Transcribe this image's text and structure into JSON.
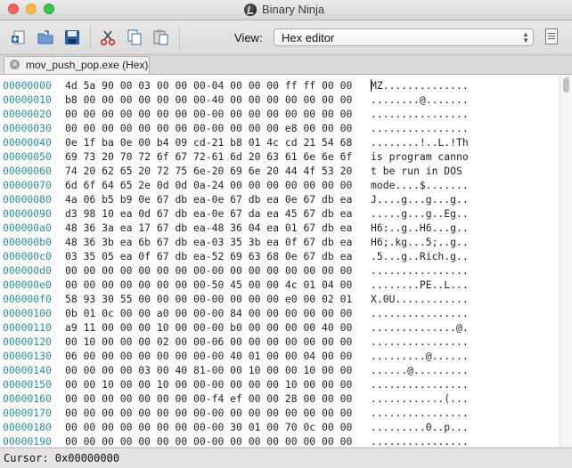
{
  "window": {
    "title": "Binary Ninja",
    "colors": {
      "close": "#fc605c",
      "minimize": "#fdbc40",
      "maximize": "#34c84a"
    }
  },
  "toolbar": {
    "buttons": [
      "new-file-icon",
      "open-file-icon",
      "save-icon",
      "cut-icon",
      "copy-icon",
      "paste-icon"
    ],
    "view_label": "View:",
    "view_value": "Hex editor"
  },
  "tab": {
    "label": "mov_push_pop.exe (Hex)"
  },
  "hex": {
    "address_color": "#2a8e9c",
    "rows": [
      {
        "addr": "00000000",
        "bytes": "4d 5a 90 00 03 00 00 00-04 00 00 00 ff ff 00 00",
        "ascii": "MZ.............."
      },
      {
        "addr": "00000010",
        "bytes": "b8 00 00 00 00 00 00 00-40 00 00 00 00 00 00 00",
        "ascii": "........@......."
      },
      {
        "addr": "00000020",
        "bytes": "00 00 00 00 00 00 00 00-00 00 00 00 00 00 00 00",
        "ascii": "................"
      },
      {
        "addr": "00000030",
        "bytes": "00 00 00 00 00 00 00 00-00 00 00 00 e8 00 00 00",
        "ascii": "................"
      },
      {
        "addr": "00000040",
        "bytes": "0e 1f ba 0e 00 b4 09 cd-21 b8 01 4c cd 21 54 68",
        "ascii": "........!..L.!Th"
      },
      {
        "addr": "00000050",
        "bytes": "69 73 20 70 72 6f 67 72-61 6d 20 63 61 6e 6e 6f",
        "ascii": "is program canno"
      },
      {
        "addr": "00000060",
        "bytes": "74 20 62 65 20 72 75 6e-20 69 6e 20 44 4f 53 20",
        "ascii": "t be run in DOS "
      },
      {
        "addr": "00000070",
        "bytes": "6d 6f 64 65 2e 0d 0d 0a-24 00 00 00 00 00 00 00",
        "ascii": "mode....$......."
      },
      {
        "addr": "00000080",
        "bytes": "4a 06 b5 b9 0e 67 db ea-0e 67 db ea 0e 67 db ea",
        "ascii": "J....g...g...g.."
      },
      {
        "addr": "00000090",
        "bytes": "d3 98 10 ea 0d 67 db ea-0e 67 da ea 45 67 db ea",
        "ascii": ".....g...g..Eg.."
      },
      {
        "addr": "000000a0",
        "bytes": "48 36 3a ea 17 67 db ea-48 36 04 ea 01 67 db ea",
        "ascii": "H6:..g..H6...g.."
      },
      {
        "addr": "000000b0",
        "bytes": "48 36 3b ea 6b 67 db ea-03 35 3b ea 0f 67 db ea",
        "ascii": "H6;.kg...5;..g.."
      },
      {
        "addr": "000000c0",
        "bytes": "03 35 05 ea 0f 67 db ea-52 69 63 68 0e 67 db ea",
        "ascii": ".5...g..Rich.g.."
      },
      {
        "addr": "000000d0",
        "bytes": "00 00 00 00 00 00 00 00-00 00 00 00 00 00 00 00",
        "ascii": "................"
      },
      {
        "addr": "000000e0",
        "bytes": "00 00 00 00 00 00 00 00-50 45 00 00 4c 01 04 00",
        "ascii": "........PE..L..."
      },
      {
        "addr": "000000f0",
        "bytes": "58 93 30 55 00 00 00 00-00 00 00 00 e0 00 02 01",
        "ascii": "X.0U............"
      },
      {
        "addr": "00000100",
        "bytes": "0b 01 0c 00 00 a0 00 00-00 84 00 00 00 00 00 00",
        "ascii": "................"
      },
      {
        "addr": "00000110",
        "bytes": "a9 11 00 00 00 10 00 00-00 b0 00 00 00 00 40 00",
        "ascii": "..............@."
      },
      {
        "addr": "00000120",
        "bytes": "00 10 00 00 00 02 00 00-06 00 00 00 00 00 00 00",
        "ascii": "................"
      },
      {
        "addr": "00000130",
        "bytes": "06 00 00 00 00 00 00 00-00 40 01 00 00 04 00 00",
        "ascii": ".........@......"
      },
      {
        "addr": "00000140",
        "bytes": "00 00 00 00 03 00 40 81-00 00 10 00 00 10 00 00",
        "ascii": "......@........."
      },
      {
        "addr": "00000150",
        "bytes": "00 00 10 00 00 10 00 00-00 00 00 00 10 00 00 00",
        "ascii": "................"
      },
      {
        "addr": "00000160",
        "bytes": "00 00 00 00 00 00 00 00-f4 ef 00 00 28 00 00 00",
        "ascii": "............(..."
      },
      {
        "addr": "00000170",
        "bytes": "00 00 00 00 00 00 00 00-00 00 00 00 00 00 00 00",
        "ascii": "................"
      },
      {
        "addr": "00000180",
        "bytes": "00 00 00 00 00 00 00 00-00 30 01 00 70 0c 00 00",
        "ascii": ".........0..p..."
      },
      {
        "addr": "00000190",
        "bytes": "00 00 00 00 00 00 00 00-00 00 00 00 00 00 00 00",
        "ascii": "................"
      }
    ]
  },
  "status": {
    "cursor_text": "Cursor: 0x00000000"
  }
}
